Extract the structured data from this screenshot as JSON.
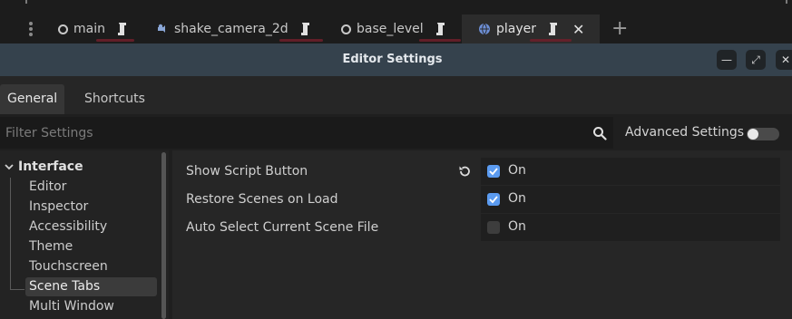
{
  "scene_tabs": [
    {
      "label": "main",
      "icon": "scene-circle-icon",
      "active": false
    },
    {
      "label": "shake_camera_2d",
      "icon": "node-icon",
      "active": false
    },
    {
      "label": "base_level",
      "icon": "scene-circle-icon",
      "active": false
    },
    {
      "label": "player",
      "icon": "globe-icon",
      "active": true
    }
  ],
  "dialog": {
    "title": "Editor Settings"
  },
  "tabs": [
    "General",
    "Shortcuts"
  ],
  "filter": {
    "placeholder": "Filter Settings",
    "value": ""
  },
  "advanced": {
    "label": "Advanced Settings",
    "enabled": false
  },
  "sidebar": {
    "category": "Interface",
    "items": [
      "Editor",
      "Inspector",
      "Accessibility",
      "Theme",
      "Touchscreen",
      "Scene Tabs",
      "Multi Window"
    ],
    "selected": "Scene Tabs"
  },
  "properties": [
    {
      "label": "Show Script Button",
      "value_text": "On",
      "checked": true
    },
    {
      "label": "Restore Scenes on Load",
      "value_text": "On",
      "checked": true
    },
    {
      "label": "Auto Select Current Scene File",
      "value_text": "On",
      "checked": false
    }
  ],
  "colors": {
    "accent": "#5b9bf0",
    "titlebar": "#35424d",
    "tab_underline": "#6a1f2a"
  }
}
